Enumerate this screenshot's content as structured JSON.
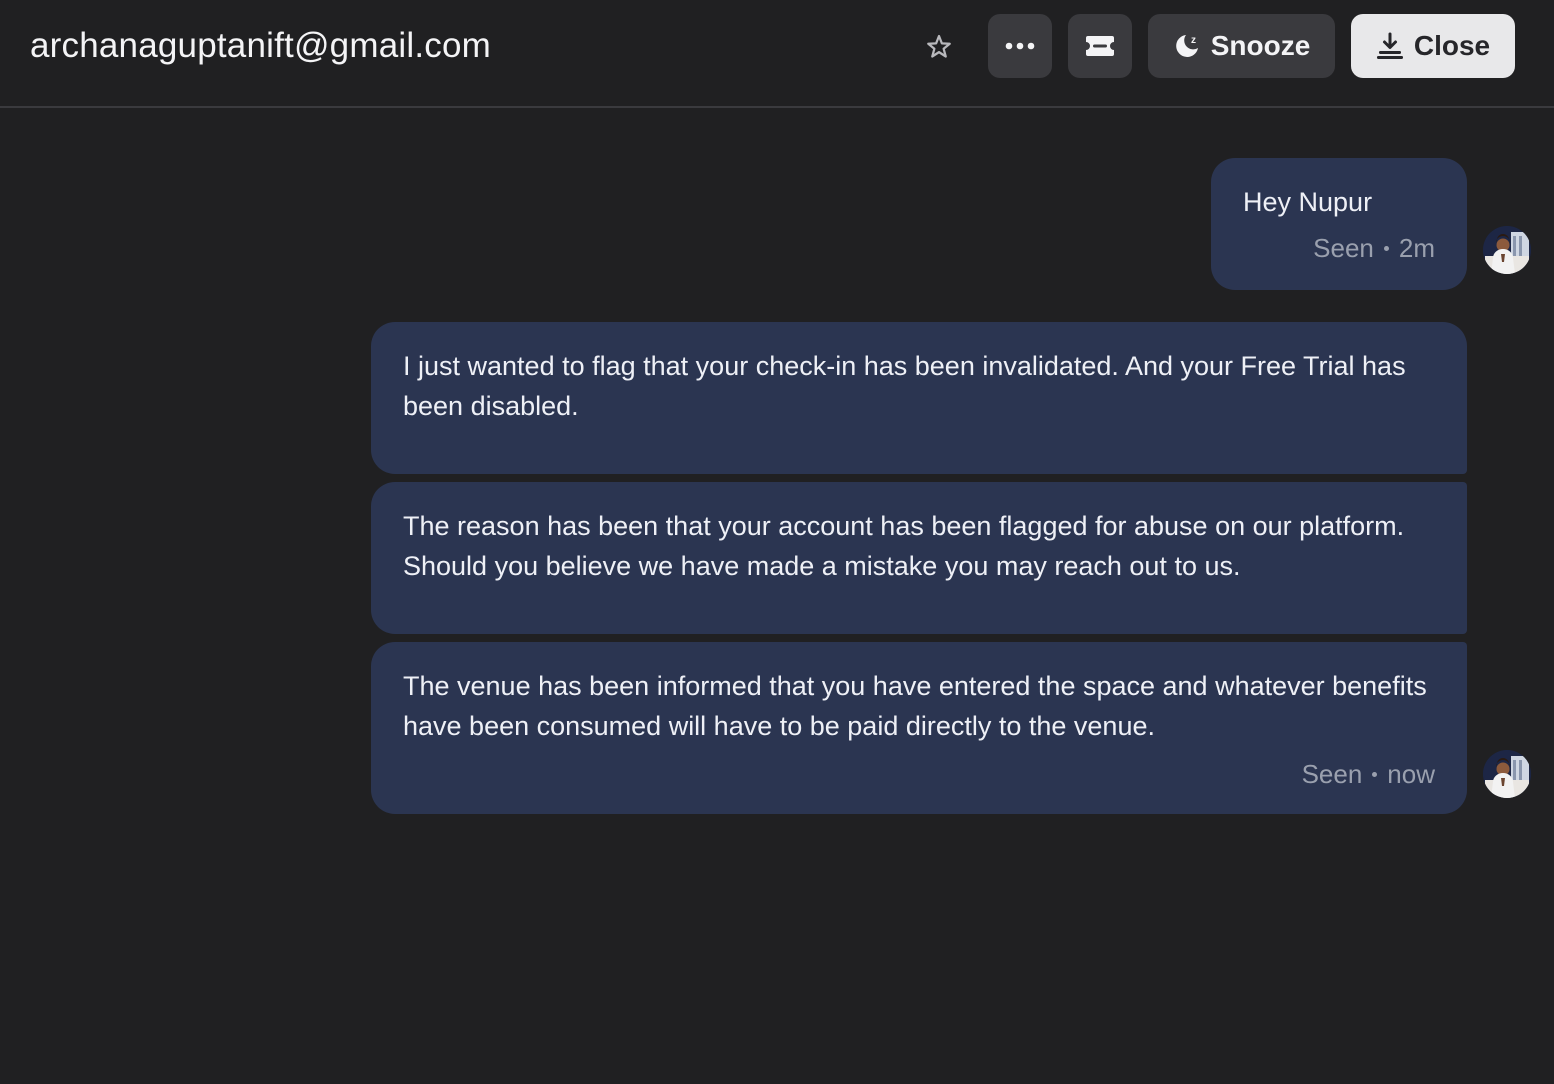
{
  "header": {
    "title": "archanaguptanift@gmail.com",
    "buttons": {
      "star": "star-icon",
      "more": "more-icon",
      "ticket": "ticket-icon",
      "snooze_label": "Snooze",
      "close_label": "Close"
    }
  },
  "messages": [
    {
      "text": "Hey Nupur",
      "status": "Seen",
      "time": "2m"
    },
    {
      "text": "I just wanted to flag that your check-in has been invalidated. And your Free Trial has been disabled."
    },
    {
      "text": "The reason has been that your account has been flagged for abuse on our platform. Should you believe we have made a mistake you may reach out to us."
    },
    {
      "text": "The venue has been informed that you have entered the space and whatever benefits have been consumed will have to be paid directly to the venue.",
      "status": "Seen",
      "time": "now"
    }
  ],
  "colors": {
    "background": "#202022",
    "bubble": "#2b3551",
    "button": "#3a3a3e",
    "close_button": "#e8e8ea"
  }
}
